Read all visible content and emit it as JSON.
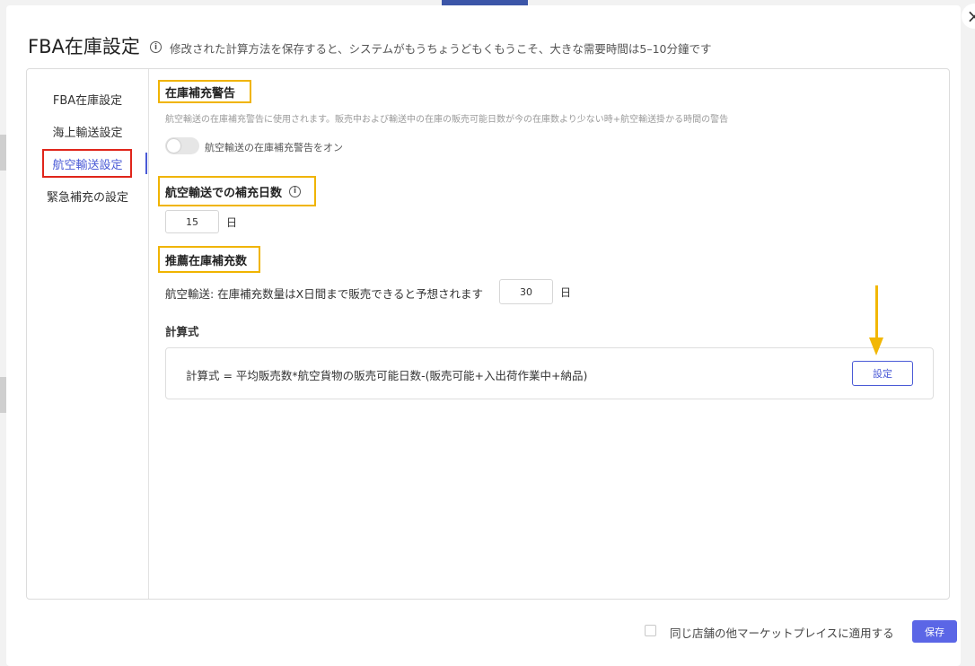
{
  "modal": {
    "title": "FBA在庫設定",
    "description": "修改された計算方法を保存すると、システムがもうちょうどもくもうこそ、大きな需要時間は5–10分鐘です",
    "close_label": "×"
  },
  "sidebar": {
    "items": [
      {
        "label": "FBA在庫設定"
      },
      {
        "label": "海上輸送設定"
      },
      {
        "label": "航空輸送設定",
        "active": true
      },
      {
        "label": "緊急補充の設定"
      }
    ]
  },
  "restock_warning": {
    "title": "在庫補充警告",
    "hint": "航空輸送の在庫補充警告に使用されます。販売中および輸送中の在庫の販売可能日数が今の在庫数より少ない時+航空輸送掛かる時間の警告",
    "toggle_label": "航空輸送の在庫補充警告をオン",
    "toggle_on": false
  },
  "replenish_days": {
    "title": "航空輸送での補充日数",
    "value": "15",
    "unit": "日"
  },
  "recommended": {
    "title": "推薦在庫補充数",
    "sentence": "航空輸送: 在庫補充数量はX日間まで販売できると予想されます",
    "value": "30",
    "unit": "日"
  },
  "formula": {
    "heading": "計算式",
    "text": "計算式 = 平均販売数*航空貨物の販売可能日数-(販売可能+入出荷作業中+納品)",
    "button_label": "設定"
  },
  "footer": {
    "apply_label": "同じ店舗の他マーケットプレイスに適用する",
    "apply_checked": false,
    "save_label": "保存"
  },
  "colors": {
    "accent": "#4a5ad6",
    "highlight_box": "#f0b400",
    "active_box": "#e0251a",
    "arrow": "#f2b705",
    "save_button": "#5b66e6"
  }
}
